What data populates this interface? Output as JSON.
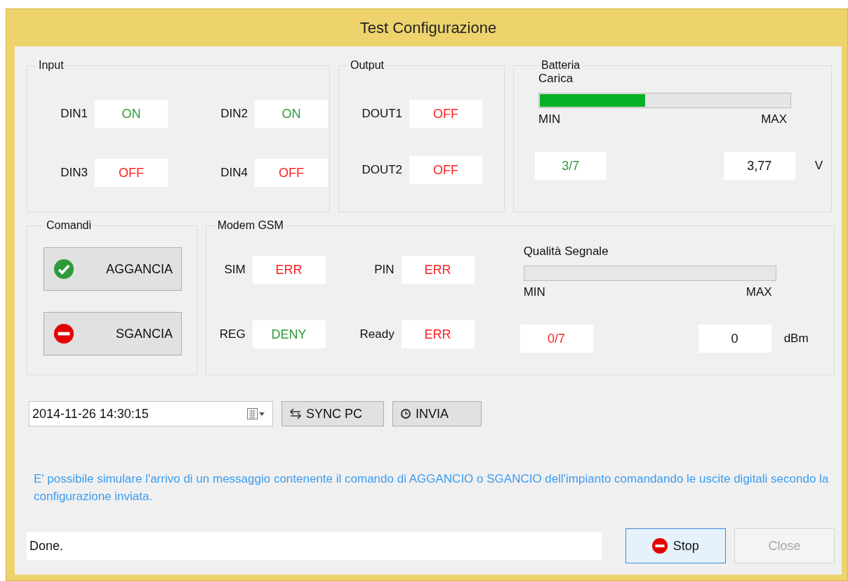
{
  "window": {
    "title": "Test Configurazione"
  },
  "input": {
    "title": "Input",
    "fields": [
      {
        "label": "DIN1",
        "value": "ON",
        "color": "#2f9a3a"
      },
      {
        "label": "DIN2",
        "value": "ON",
        "color": "#2f9a3a"
      },
      {
        "label": "DIN3",
        "value": "OFF",
        "color": "#ff1f1f"
      },
      {
        "label": "DIN4",
        "value": "OFF",
        "color": "#ff1f1f"
      }
    ]
  },
  "output": {
    "title": "Output",
    "fields": [
      {
        "label": "DOUT1",
        "value": "OFF",
        "color": "#ff1f1f"
      },
      {
        "label": "DOUT2",
        "value": "OFF",
        "color": "#ff1f1f"
      }
    ]
  },
  "battery": {
    "title": "Batteria",
    "label": "Carica",
    "level": 0.42,
    "min": "MIN",
    "max": "MAX",
    "count": {
      "value": "3/7",
      "color": "#2f9a3a"
    },
    "reading": "3,77",
    "unit": "V"
  },
  "commands": {
    "title": "Comandi",
    "buttons": [
      {
        "label": "AGGANCIA",
        "kind": "check"
      },
      {
        "label": "SGANCIA",
        "kind": "stop"
      }
    ]
  },
  "modem": {
    "title": "Modem GSM",
    "fields": [
      {
        "label": "SIM",
        "value": "ERR",
        "color": "#ff1f1f"
      },
      {
        "label": "PIN",
        "value": "ERR",
        "color": "#ff1f1f"
      },
      {
        "label": "REG",
        "value": "DENY",
        "color": "#2f9a3a"
      },
      {
        "label": "Ready",
        "value": "ERR",
        "color": "#ff1f1f"
      }
    ],
    "signal": {
      "label": "Qualità Segnale",
      "min": "MIN",
      "max": "MAX",
      "count": {
        "value": "0/7",
        "color": "#ff1f1f"
      },
      "reading": "0",
      "unit": "dBm"
    }
  },
  "datetime": {
    "value": "2014-11-26 14:30:15"
  },
  "actions": [
    {
      "label": "SYNC PC",
      "kind": "sync"
    },
    {
      "label": "INVIA",
      "kind": "clock"
    }
  ],
  "message": "E' possibile simulare l'arrivo di un messaggio contenente il comando di AGGANCIO o SGANCIO dell'impianto comandando le uscite digitali secondo la configurazione inviata.",
  "status": {
    "value": "Done."
  },
  "footer_buttons": [
    {
      "label": "Stop",
      "kind": "stop",
      "disabled": false,
      "focused": true
    },
    {
      "label": "Close",
      "kind": "plain",
      "disabled": true,
      "focused": false
    }
  ]
}
